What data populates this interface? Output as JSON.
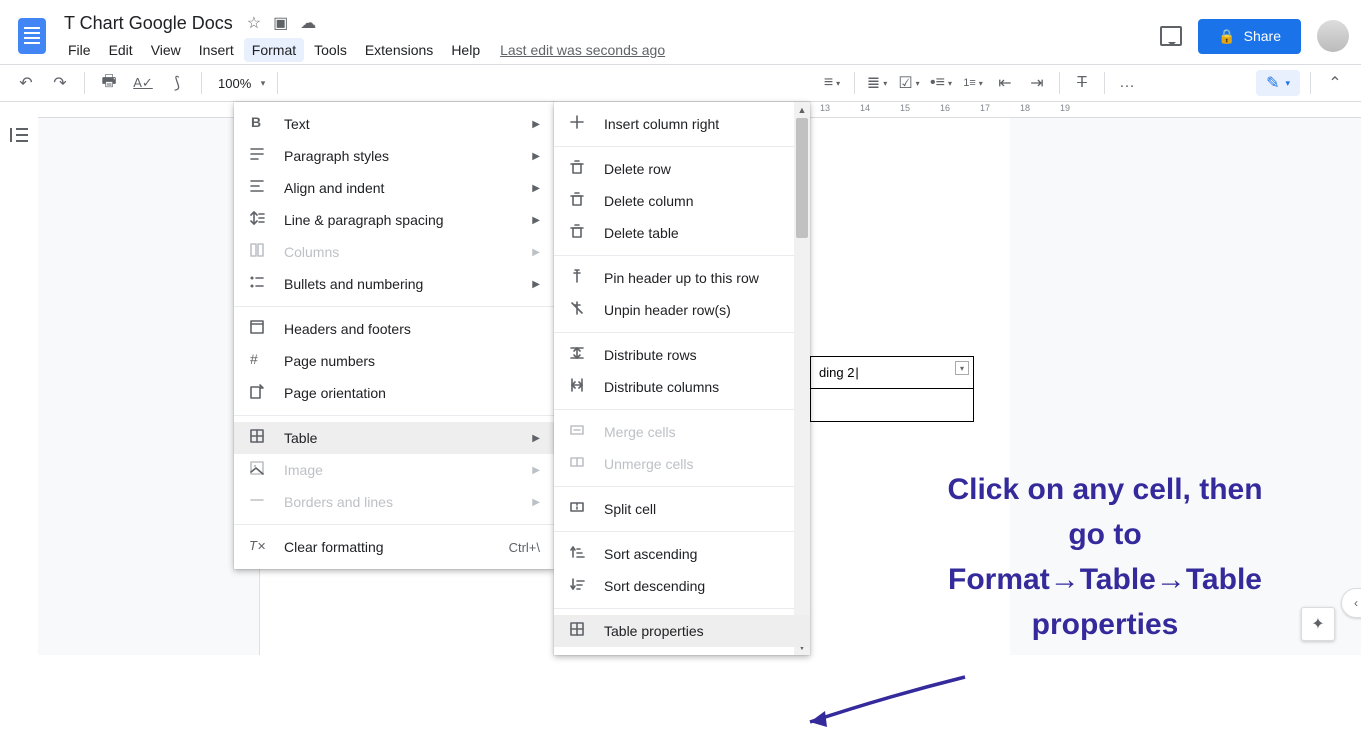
{
  "header": {
    "title": "T Chart Google Docs",
    "menus": [
      "File",
      "Edit",
      "View",
      "Insert",
      "Format",
      "Tools",
      "Extensions",
      "Help"
    ],
    "active_menu_index": 4,
    "last_edit": "Last edit was seconds ago",
    "share_label": "Share"
  },
  "toolbar": {
    "zoom": "100%",
    "ruler_numbers_right": [
      "13",
      "14",
      "15",
      "16",
      "17",
      "18",
      "19"
    ],
    "more_label": "…"
  },
  "format_menu": [
    {
      "label": "Text",
      "arrow": true,
      "icon": "bold"
    },
    {
      "label": "Paragraph styles",
      "arrow": true,
      "icon": "para"
    },
    {
      "label": "Align and indent",
      "arrow": true,
      "icon": "align"
    },
    {
      "label": "Line & paragraph spacing",
      "arrow": true,
      "icon": "spacing"
    },
    {
      "label": "Columns",
      "arrow": true,
      "disabled": true,
      "icon": "columns"
    },
    {
      "label": "Bullets and numbering",
      "arrow": true,
      "icon": "bullets"
    },
    {
      "sep": true
    },
    {
      "label": "Headers and footers",
      "icon": "hf"
    },
    {
      "label": "Page numbers",
      "icon": "hash"
    },
    {
      "label": "Page orientation",
      "icon": "orient"
    },
    {
      "sep": true
    },
    {
      "label": "Table",
      "arrow": true,
      "highlight": true,
      "icon": "table"
    },
    {
      "label": "Image",
      "arrow": true,
      "disabled": true,
      "icon": "image"
    },
    {
      "label": "Borders and lines",
      "arrow": true,
      "disabled": true,
      "icon": "line"
    },
    {
      "sep": true
    },
    {
      "label": "Clear formatting",
      "shortcut": "Ctrl+\\",
      "icon": "clear"
    }
  ],
  "table_submenu": [
    {
      "label": "Insert column right",
      "icon": "plus"
    },
    {
      "sep": true
    },
    {
      "label": "Delete row",
      "icon": "trash"
    },
    {
      "label": "Delete column",
      "icon": "trash"
    },
    {
      "label": "Delete table",
      "icon": "trash"
    },
    {
      "sep": true
    },
    {
      "label": "Pin header up to this row",
      "icon": "pin"
    },
    {
      "label": "Unpin header row(s)",
      "icon": "unpin"
    },
    {
      "sep": true
    },
    {
      "label": "Distribute rows",
      "icon": "distrow"
    },
    {
      "label": "Distribute columns",
      "icon": "distcol"
    },
    {
      "sep": true
    },
    {
      "label": "Merge cells",
      "disabled": true,
      "icon": "merge"
    },
    {
      "label": "Unmerge cells",
      "disabled": true,
      "icon": "unmerge"
    },
    {
      "sep": true
    },
    {
      "label": "Split cell",
      "icon": "split"
    },
    {
      "sep": true
    },
    {
      "label": "Sort ascending",
      "icon": "sortasc"
    },
    {
      "label": "Sort descending",
      "icon": "sortdesc"
    },
    {
      "sep": true
    },
    {
      "label": "Table properties",
      "highlight": true,
      "icon": "table"
    }
  ],
  "doc_table_cell": "ding 2",
  "annotation": {
    "line1": "Click on any cell, then",
    "line2": "go to",
    "line3": "Format→Table→Table",
    "line4": "properties"
  }
}
